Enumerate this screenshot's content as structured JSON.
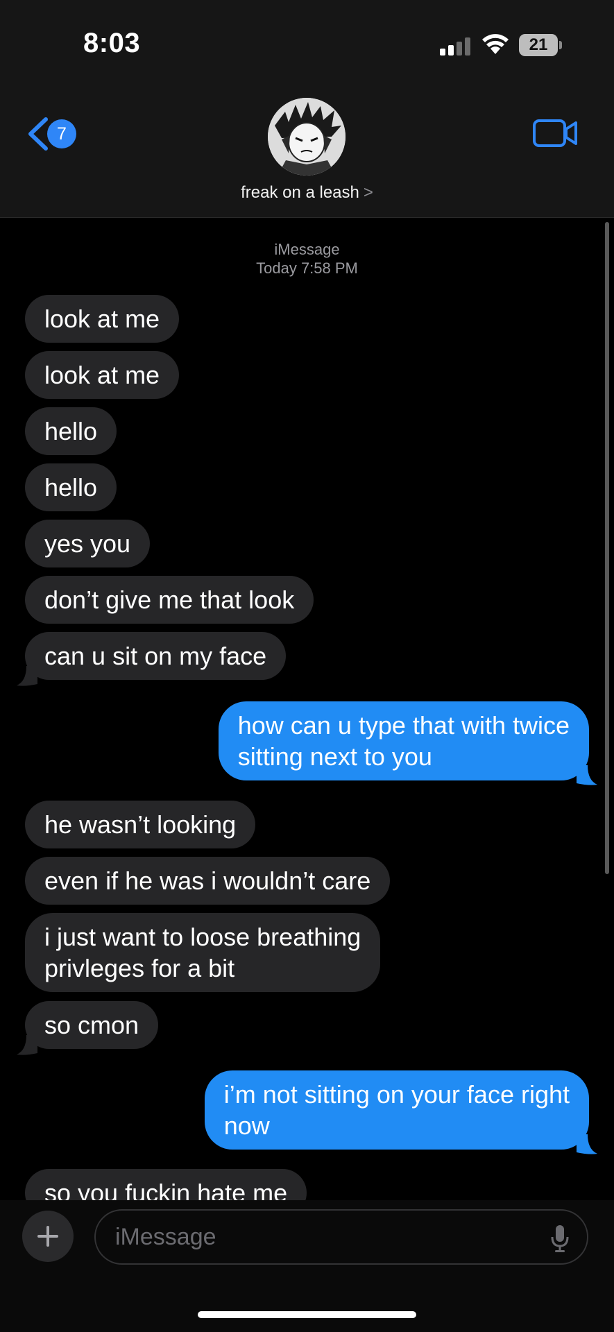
{
  "status_bar": {
    "time": "8:03",
    "battery_level": "21",
    "signal_icon": "cellular-signal-icon",
    "wifi_icon": "wifi-icon"
  },
  "header": {
    "back_badge_count": "7",
    "contact_name": "freak on a leash",
    "chevron": ">",
    "accent_color": "#2f86f7"
  },
  "thread": {
    "service": "iMessage",
    "timestamp": "Today 7:58 PM",
    "messages": [
      {
        "from": "them",
        "text": "look at me"
      },
      {
        "from": "them",
        "text": "look at me"
      },
      {
        "from": "them",
        "text": "hello"
      },
      {
        "from": "them",
        "text": "hello"
      },
      {
        "from": "them",
        "text": "yes you"
      },
      {
        "from": "them",
        "text": "don’t give me that look"
      },
      {
        "from": "them",
        "text": "can u sit on my face"
      },
      {
        "from": "me",
        "text": "how can u type that with twice\nsitting next to you"
      },
      {
        "from": "them",
        "text": "he wasn’t looking"
      },
      {
        "from": "them",
        "text": "even if he was i wouldn’t care"
      },
      {
        "from": "them",
        "text": "i just want to loose breathing\nprivleges for a bit"
      },
      {
        "from": "them",
        "text": "so cmon"
      },
      {
        "from": "me",
        "text": "i’m not sitting on your face right\nnow"
      },
      {
        "from": "them",
        "text": "so you fuckin hate me"
      }
    ]
  },
  "composer": {
    "placeholder": "iMessage"
  },
  "colors": {
    "incoming_bubble": "#262628",
    "outgoing_bubble": "#218cf4",
    "background": "#000000"
  }
}
